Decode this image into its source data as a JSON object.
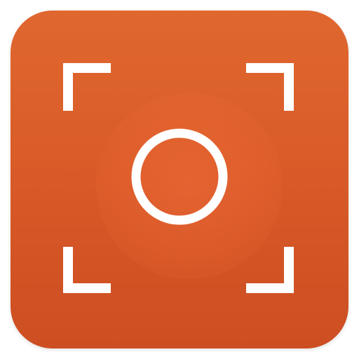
{
  "app_icon": {
    "icon_name": "screen-capture-icon",
    "background_color": "#d85a28",
    "glyph_color": "#ffffff"
  }
}
